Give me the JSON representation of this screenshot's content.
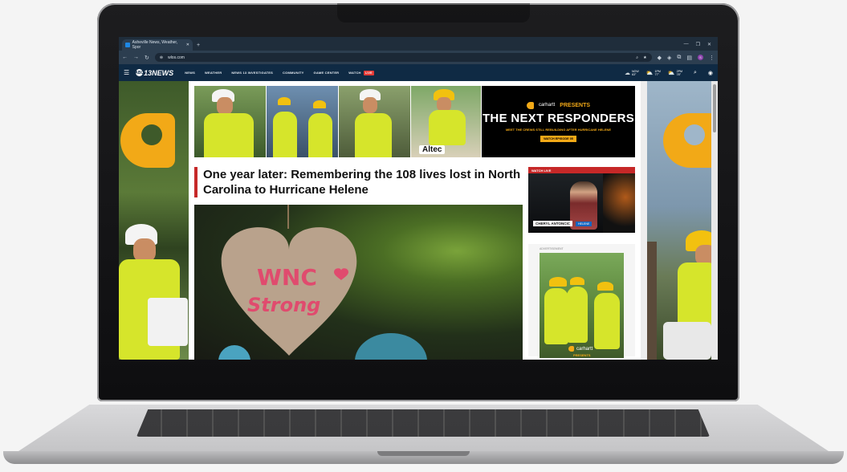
{
  "browser": {
    "tab_title": "Asheville News, Weather, Spor",
    "tab_close": "✕",
    "new_tab": "+",
    "url": "wlos.com",
    "window_controls": [
      "—",
      "❐",
      "✕"
    ]
  },
  "site": {
    "logo": "13NEWS",
    "logo_prefix": "ABC",
    "nav": [
      "NEWS",
      "WEATHER",
      "NEWS 13 INVESTIGATES",
      "COMMUNITY",
      "GAME CENTER",
      "WATCH"
    ],
    "live_badge": "LIVE",
    "weather": [
      {
        "label": "NOW",
        "temp": "63°"
      },
      {
        "label": "1PM",
        "temp": "77°"
      },
      {
        "label": "2PM",
        "temp": "78°"
      }
    ]
  },
  "banner": {
    "brand": "carhartt",
    "presents": "PRESENTS",
    "title": "THE NEXT RESPONDERS",
    "subtitle": "MEET THE CREWS STILL REBUILDING AFTER HURRICANE HELENE",
    "cta": "WATCH EPISODE 05",
    "truck_label": "Altec"
  },
  "article": {
    "headline": "One year later: Remembering the 108 lives lost in North Carolina to Hurricane Helene",
    "heart_line1": "WNC",
    "heart_line2": "Strong"
  },
  "sidebar": {
    "watch_live": "WATCH LIVE",
    "lower_third_name": "CHERYL ANTONCIC",
    "lower_third_tag": "HELENE",
    "ad_label": "ADVERTISEMENT",
    "ad_brand": "carhartt",
    "ad_presents": "PRESENTS"
  },
  "colors": {
    "accent_red": "#c62828",
    "carhartt_gold": "#f2a917",
    "nav_navy": "#0f2a44"
  }
}
